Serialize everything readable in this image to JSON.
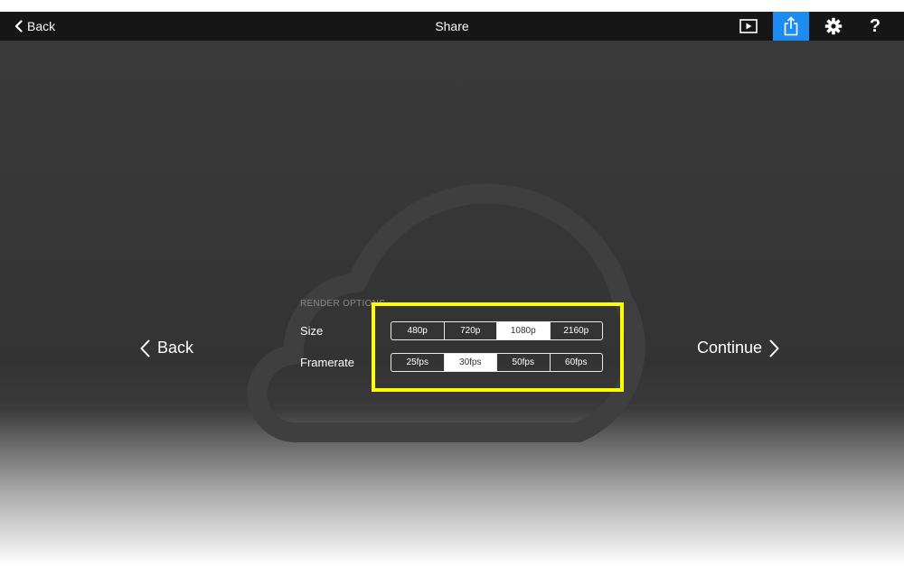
{
  "topbar": {
    "back_label": "Back",
    "title": "Share",
    "buttons": [
      {
        "icon": "play-icon"
      },
      {
        "icon": "share-icon",
        "active": true,
        "active_color": "#1c8cf2"
      },
      {
        "icon": "gear-icon"
      },
      {
        "icon": "help-icon",
        "glyph": "?"
      }
    ]
  },
  "render_options": {
    "heading": "RENDER OPTIONS",
    "size": {
      "label": "Size",
      "options": [
        "480p",
        "720p",
        "1080p",
        "2160p"
      ],
      "selected": "1080p"
    },
    "framerate": {
      "label": "Framerate",
      "options": [
        "25fps",
        "30fps",
        "50fps",
        "60fps"
      ],
      "selected": "30fps"
    }
  },
  "navigation": {
    "back_label": "Back",
    "continue_label": "Continue"
  },
  "highlight_color": "#ffff00"
}
